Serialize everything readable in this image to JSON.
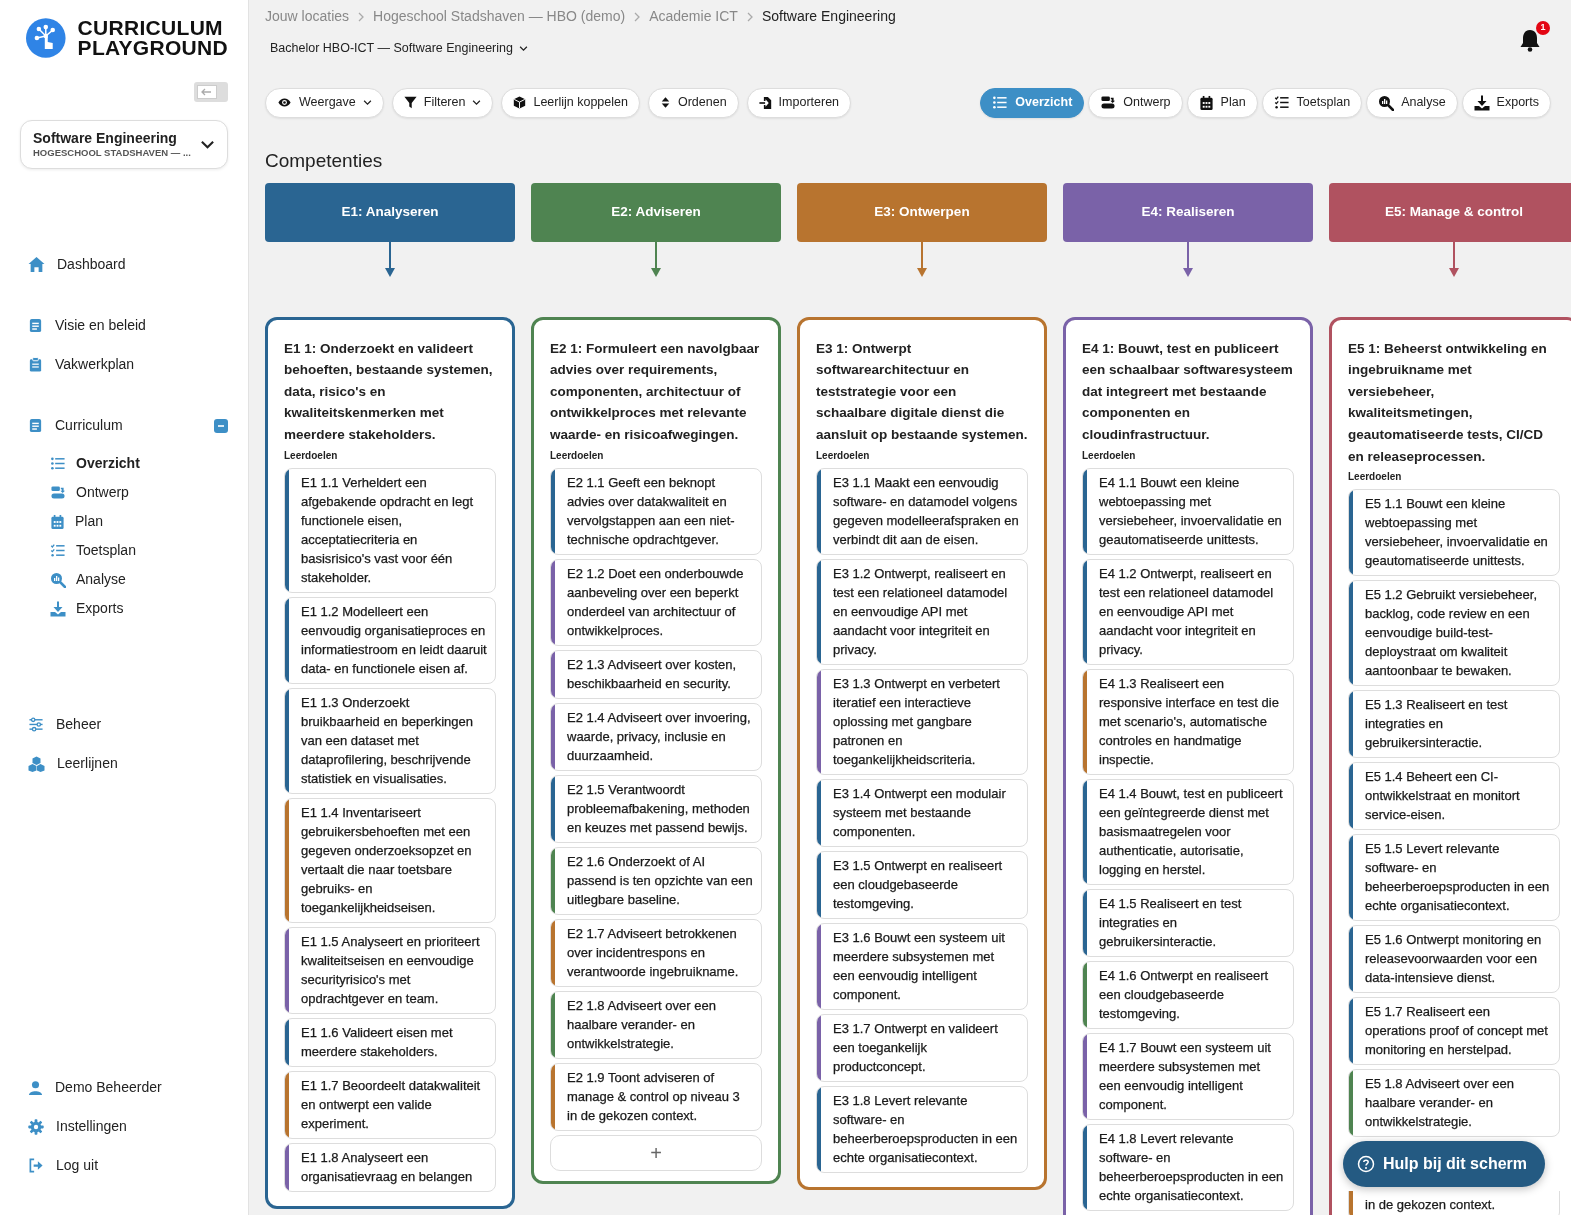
{
  "sidebar": {
    "logo": [
      "CURRICULUM",
      "PLAYGROUND"
    ],
    "program": {
      "title": "Software Engineering",
      "subtitle": "HOGESCHOOL STADSHAVEN — ..."
    },
    "nav_groups": [
      [
        {
          "label": "Dashboard",
          "selected": false
        }
      ],
      [
        {
          "label": "Visie en beleid",
          "selected": false
        },
        {
          "label": "Vakwerkplan",
          "selected": false
        }
      ],
      [
        {
          "label": "Curriculum",
          "selected": false,
          "expanded": true,
          "children": [
            {
              "label": "Overzicht",
              "selected": true
            },
            {
              "label": "Ontwerp",
              "selected": false
            },
            {
              "label": "Plan",
              "selected": false
            },
            {
              "label": "Toetsplan",
              "selected": false
            },
            {
              "label": "Analyse",
              "selected": false
            },
            {
              "label": "Exports",
              "selected": false
            }
          ]
        }
      ],
      [
        {
          "label": "Beheer",
          "selected": false
        },
        {
          "label": "Leerlijnen",
          "selected": false
        }
      ]
    ],
    "account": [
      {
        "label": "Demo Beheerder"
      },
      {
        "label": "Instellingen"
      },
      {
        "label": "Log uit"
      }
    ]
  },
  "breadcrumb": [
    "Jouw locaties",
    "Hogeschool Stadshaven — HBO (demo)",
    "Academie ICT",
    "Software Engineering"
  ],
  "program_select": "Bachelor HBO-ICT — Software Engineering",
  "notifications": {
    "count": "1"
  },
  "toolbar": [
    {
      "label": "Weergave",
      "dropdown": true
    },
    {
      "label": "Filteren",
      "dropdown": true
    },
    {
      "label": "Leerlijn koppelen",
      "dropdown": false
    },
    {
      "label": "Ordenen",
      "dropdown": false
    },
    {
      "label": "Importeren",
      "dropdown": false
    }
  ],
  "views": [
    {
      "label": "Overzicht",
      "selected": true
    },
    {
      "label": "Ontwerp",
      "selected": false
    },
    {
      "label": "Plan",
      "selected": false
    },
    {
      "label": "Toetsplan",
      "selected": false
    },
    {
      "label": "Analyse",
      "selected": false
    },
    {
      "label": "Exports",
      "selected": false
    }
  ],
  "section_title": "Competenties",
  "competencies": [
    {
      "header": "E1: Analyseren",
      "color": "#2a6592",
      "title": "E1 1: Onderzoekt en valideert behoeften, bestaande systemen, data, risico's en kwaliteitskenmerken met meerdere stakeholders.",
      "subheading": "Leerdoelen",
      "goals": [
        {
          "text": "E1 1.1 Verheldert een afgebakende opdracht en legt functionele eisen, acceptatiecriteria en basisrisico's vast voor één stakeholder.",
          "color": "#2a6592"
        },
        {
          "text": "E1 1.2 Modelleert een eenvoudig organisatieproces en informatiestroom en leidt daaruit data- en functionele eisen af.",
          "color": "#2a6592"
        },
        {
          "text": "E1 1.3 Onderzoekt bruikbaarheid en beperkingen van een dataset met dataprofilering, beschrijvende statistiek en visualisaties.",
          "color": "#2a6592"
        },
        {
          "text": "E1 1.4 Inventariseert gebruikersbehoeften met een gegeven onderzoeksopzet en vertaalt die naar toetsbare gebruiks- en toegankelijkheidseisen.",
          "color": "#b8742f"
        },
        {
          "text": "E1 1.5 Analyseert en prioriteert kwaliteitseisen en eenvoudige securityrisico's met opdrachtgever en team.",
          "color": "#7a62a8"
        },
        {
          "text": "E1 1.6 Valideert eisen met meerdere stakeholders.",
          "color": "#2a6592"
        },
        {
          "text": "E1 1.7 Beoordeelt datakwaliteit en ontwerpt een valide experiment.",
          "color": "#b8742f"
        },
        {
          "text": "E1 1.8 Analyseert een organisatievraag en belangen",
          "color": "#7a62a8"
        }
      ]
    },
    {
      "header": "E2: Adviseren",
      "color": "#4f8451",
      "title": "E2 1: Formuleert een navolgbaar advies over requirements, componenten, architectuur of ontwikkelproces met relevante waarde- en risicoafwegingen.",
      "subheading": "Leerdoelen",
      "add_button": "+",
      "goals": [
        {
          "text": "E2 1.1 Geeft een beknopt advies over datakwaliteit en vervolgstappen aan een niet-technische opdrachtgever.",
          "color": "#2a6592"
        },
        {
          "text": "E2 1.2 Doet een onderbouwde aanbeveling over een beperkt onderdeel van architectuur of ontwikkelproces.",
          "color": "#7a62a8"
        },
        {
          "text": "E2 1.3 Adviseert over kosten, beschikbaarheid en security.",
          "color": "#7a62a8"
        },
        {
          "text": "E2 1.4 Adviseert over invoering, waarde, privacy, inclusie en duurzaamheid.",
          "color": "#7a62a8"
        },
        {
          "text": "E2 1.5 Verantwoordt probleemafbakening, methoden en keuzes met passend bewijs.",
          "color": "#2a6592"
        },
        {
          "text": "E2 1.6 Onderzoekt of AI passend is ten opzichte van een uitlegbare baseline.",
          "color": "#4f8451"
        },
        {
          "text": "E2 1.7 Adviseert betrokkenen over incidentrespons en verantwoorde ingebruikname.",
          "color": "#b8742f"
        },
        {
          "text": "E2 1.8 Adviseert over een haalbare verander- en ontwikkelstrategie.",
          "color": "#4f8451"
        },
        {
          "text": "E2 1.9 Toont adviseren of manage & control op niveau 3 in de gekozen context.",
          "color": "#b8742f"
        }
      ]
    },
    {
      "header": "E3: Ontwerpen",
      "color": "#b8742f",
      "title": "E3 1: Ontwerpt softwarearchitectuur en teststrategie voor een schaalbare digitale dienst die aansluit op bestaande systemen.",
      "subheading": "Leerdoelen",
      "goals": [
        {
          "text": "E3 1.1 Maakt een eenvoudig software- en datamodel volgens gegeven modelleerafspraken en verbindt dit aan de eisen.",
          "color": "#2a6592"
        },
        {
          "text": "E3 1.2 Ontwerpt, realiseert en test een relationeel datamodel en eenvoudige API met aandacht voor integriteit en privacy.",
          "color": "#2a6592"
        },
        {
          "text": "E3 1.3 Ontwerpt en verbetert iteratief een interactieve oplossing met gangbare patronen en toegankelijkheidscriteria.",
          "color": "#7a62a8"
        },
        {
          "text": "E3 1.4 Ontwerpt een modulair systeem met bestaande componenten.",
          "color": "#2a6592"
        },
        {
          "text": "E3 1.5 Ontwerpt en realiseert een cloudgebaseerde testomgeving.",
          "color": "#2a6592"
        },
        {
          "text": "E3 1.6 Bouwt een systeem uit meerdere subsystemen met een eenvoudig intelligent component.",
          "color": "#7a62a8"
        },
        {
          "text": "E3 1.7 Ontwerpt en valideert een toegankelijk productconcept.",
          "color": "#7a62a8"
        },
        {
          "text": "E3 1.8 Levert relevante software- en beheerberoepsproducten in een echte organisatiecontext.",
          "color": "#2a6592"
        }
      ]
    },
    {
      "header": "E4: Realiseren",
      "color": "#7a62a8",
      "title": "E4 1: Bouwt, test en publiceert een schaalbaar softwaresysteem dat integreert met bestaande componenten en cloudinfrastructuur.",
      "subheading": "Leerdoelen",
      "goals": [
        {
          "text": "E4 1.1 Bouwt een kleine webtoepassing met versiebeheer, invoervalidatie en geautomatiseerde unittests.",
          "color": "#2a6592"
        },
        {
          "text": "E4 1.2 Ontwerpt, realiseert en test een relationeel datamodel en eenvoudige API met aandacht voor integriteit en privacy.",
          "color": "#2a6592"
        },
        {
          "text": "E4 1.3 Realiseert een responsive interface en test die met scenario's, automatische controles en handmatige inspectie.",
          "color": "#b8742f"
        },
        {
          "text": "E4 1.4 Bouwt, test en publiceert een geïntegreerde dienst met basismaatregelen voor authenticatie, autorisatie, logging en herstel.",
          "color": "#2a6592"
        },
        {
          "text": "E4 1.5 Realiseert en test integraties en gebruikersinteractie.",
          "color": "#2a6592"
        },
        {
          "text": "E4 1.6 Ontwerpt en realiseert een cloudgebaseerde testomgeving.",
          "color": "#4f8451"
        },
        {
          "text": "E4 1.7 Bouwt een systeem uit meerdere subsystemen met een eenvoudig intelligent component.",
          "color": "#7a62a8"
        },
        {
          "text": "E4 1.8 Levert relevante software- en beheerberoepsproducten in een echte organisatiecontext.",
          "color": "#2a6592"
        }
      ]
    },
    {
      "header": "E5: Manage & control",
      "color": "#b05260",
      "title": "E5 1: Beheerst ontwikkeling en ingebruikname met versiebeheer, kwaliteitsmetingen, geautomatiseerde tests, CI/CD en releaseprocessen.",
      "subheading": "Leerdoelen",
      "goals": [
        {
          "text": "E5 1.1 Bouwt een kleine webtoepassing met versiebeheer, invoervalidatie en geautomatiseerde unittests.",
          "color": "#2a6592"
        },
        {
          "text": "E5 1.2 Gebruikt versiebeheer, backlog, code review en een eenvoudige build-test-deploystraat om kwaliteit aantoonbaar te bewaken.",
          "color": "#2a6592"
        },
        {
          "text": "E5 1.3 Realiseert en test integraties en gebruikersinteractie.",
          "color": "#2a6592"
        },
        {
          "text": "E5 1.4 Beheert een CI-ontwikkelstraat en monitort service-eisen.",
          "color": "#2a6592"
        },
        {
          "text": "E5 1.5 Levert relevante software- en beheerberoepsproducten in een echte organisatiecontext.",
          "color": "#2a6592"
        },
        {
          "text": "E5 1.6 Ontwerpt monitoring en releasevoorwaarden voor een data-intensieve dienst.",
          "color": "#2a6592"
        },
        {
          "text": "E5 1.7 Realiseert een operations proof of concept met monitoring en herstelpad.",
          "color": "#2a6592"
        },
        {
          "text": "E5 1.8 Adviseert over een haalbare verander- en ontwikkelstrategie.",
          "color": "#4f8451"
        },
        {
          "text": "in de gekozen context.",
          "color": "#b8742f",
          "covered": true
        }
      ]
    }
  ],
  "help_button": "Hulp bij dit scherm"
}
